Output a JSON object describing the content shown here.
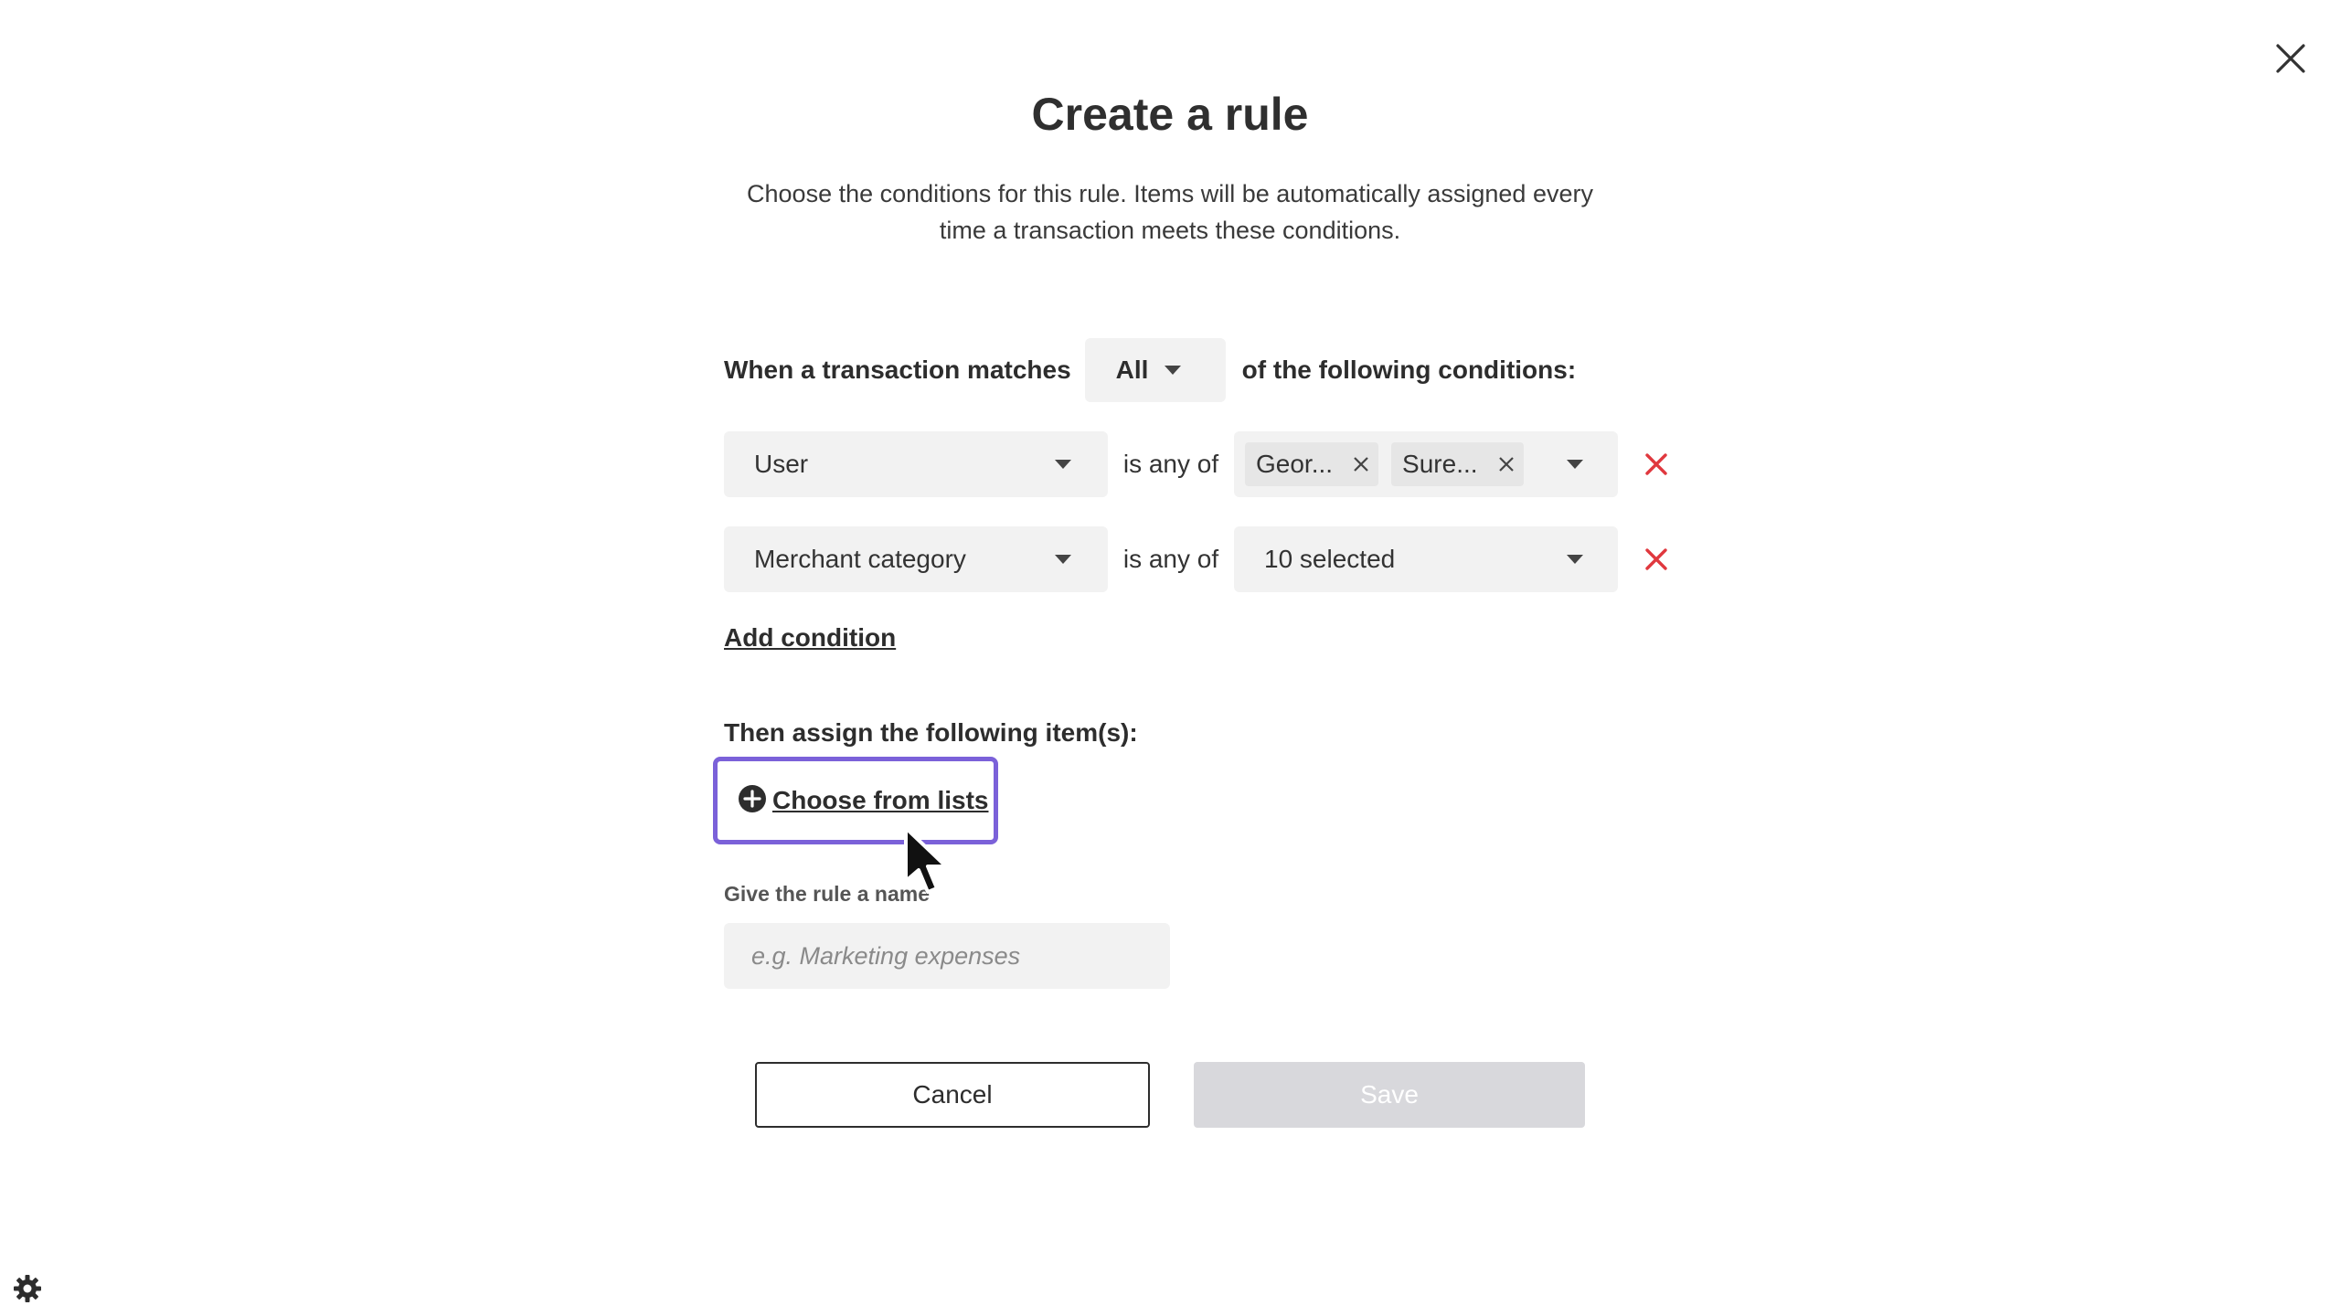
{
  "dialog": {
    "title": "Create a rule",
    "subtitle_line1": "Choose the conditions for this rule. Items will be automatically assigned every",
    "subtitle_line2": "time a transaction meets these conditions."
  },
  "match": {
    "prefix": "When a transaction matches",
    "selected": "All",
    "suffix": "of the following conditions:"
  },
  "conditions": [
    {
      "field": "User",
      "operator": "is any of",
      "chips": [
        "Geor...",
        "Sure..."
      ]
    },
    {
      "field": "Merchant category",
      "operator": "is any of",
      "value": "10 selected"
    }
  ],
  "add_condition_label": "Add condition",
  "assign": {
    "label": "Then assign the following item(s):",
    "choose_label": "Choose from lists"
  },
  "rule_name": {
    "label": "Give the rule a name",
    "placeholder": "e.g. Marketing expenses",
    "value": ""
  },
  "buttons": {
    "cancel": "Cancel",
    "save": "Save"
  },
  "colors": {
    "focus_outline": "#7b61d9",
    "remove_red": "#e0383e",
    "disabled_button": "#d8d8dc",
    "field_bg": "#f2f2f2"
  },
  "icons": {
    "close": "close-icon",
    "remove": "remove-condition-icon",
    "add": "plus-circle-icon",
    "settings": "gear-icon",
    "cursor": "mouse-cursor"
  }
}
